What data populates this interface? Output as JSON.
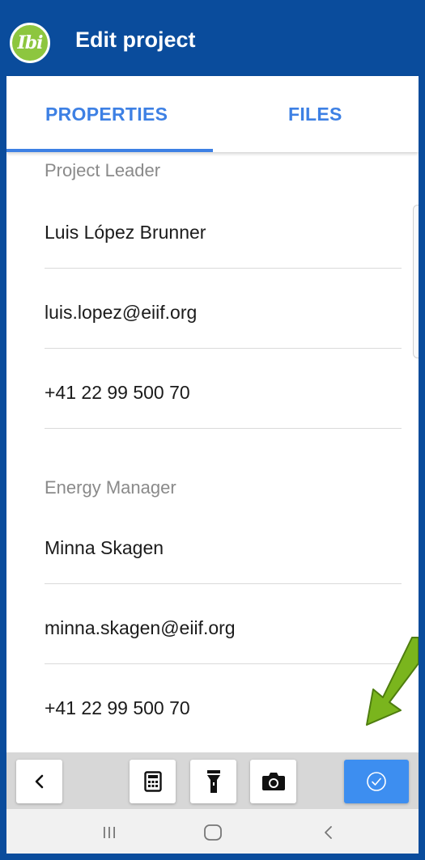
{
  "app": {
    "logo_text": "Ibi",
    "title": "Edit project"
  },
  "tabs": [
    {
      "label": "PROPERTIES",
      "active": true
    },
    {
      "label": "FILES",
      "active": false
    }
  ],
  "project_leader": {
    "section_label": "Project Leader",
    "name": "Luis López Brunner",
    "email": "luis.lopez@eiif.org",
    "phone": "+41 22 99 500 70"
  },
  "energy_manager": {
    "section_label": "Energy Manager",
    "name": "Minna Skagen",
    "email": "minna.skagen@eiif.org",
    "phone": "+41 22 99 500 70"
  },
  "toolbar": {
    "back_icon": "chevron-left-icon",
    "calculator_icon": "calculator-icon",
    "flashlight_icon": "flashlight-icon",
    "camera_icon": "camera-icon",
    "confirm_icon": "check-circle-icon"
  },
  "navbar": {
    "recents_icon": "recents-icon",
    "home_icon": "home-icon",
    "back_icon": "back-icon"
  },
  "colors": {
    "brand_blue": "#0a4c9c",
    "accent_blue": "#3d80e4",
    "logo_green": "#8dc63f",
    "arrow_green": "#7ab51d",
    "confirm_button": "#3d8ef0"
  }
}
